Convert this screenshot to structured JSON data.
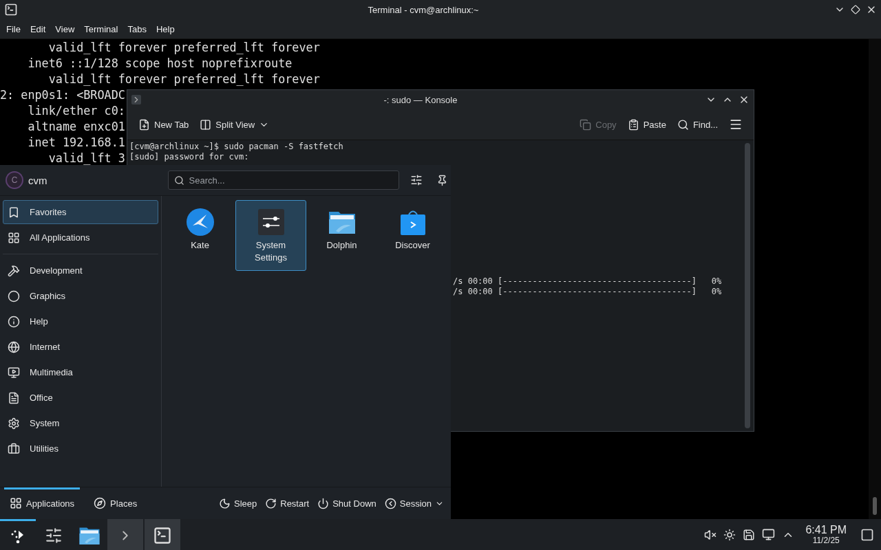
{
  "terminal_window": {
    "title": "Terminal - cvm@archlinux:~",
    "menu": [
      "File",
      "Edit",
      "View",
      "Terminal",
      "Tabs",
      "Help"
    ],
    "lines": [
      "       valid_lft forever preferred_lft forever",
      "    inet6 ::1/128 scope host noprefixroute",
      "       valid_lft forever preferred_lft forever",
      "2: enp0s1: <BROADC",
      "    link/ether c0:",
      "    altname enxc01",
      "    inet 192.168.1",
      "       valid_lft 3"
    ]
  },
  "konsole_window": {
    "title": "-: sudo — Konsole",
    "toolbar": [
      {
        "label": "New Tab",
        "disabled": false
      },
      {
        "label": "Split View",
        "disabled": false
      },
      {
        "label": "Copy",
        "disabled": true
      },
      {
        "label": "Paste",
        "disabled": false
      },
      {
        "label": "Find...",
        "disabled": false
      }
    ],
    "lines": [
      "[cvm@archlinux ~]$ sudo pacman -S fastfetch",
      "[sudo] password for cvm:"
    ],
    "progress_lines": [
      "/s 00:00 [--------------------------------------]   0%",
      "/s 00:00 [--------------------------------------]   0%"
    ]
  },
  "launcher": {
    "user": "cvm",
    "avatar_letter": "C",
    "search": {
      "placeholder": "Search..."
    },
    "categories": [
      {
        "label": "Favorites",
        "selected": true
      },
      {
        "label": "All Applications",
        "selected": false
      },
      {
        "label": "Development",
        "selected": false
      },
      {
        "label": "Graphics",
        "selected": false
      },
      {
        "label": "Help",
        "selected": false
      },
      {
        "label": "Internet",
        "selected": false
      },
      {
        "label": "Multimedia",
        "selected": false
      },
      {
        "label": "Office",
        "selected": false
      },
      {
        "label": "System",
        "selected": false
      },
      {
        "label": "Utilities",
        "selected": false
      }
    ],
    "favorites": [
      {
        "label": "Kate",
        "selected": false
      },
      {
        "label": "System Settings",
        "selected": true
      },
      {
        "label": "Dolphin",
        "selected": false
      },
      {
        "label": "Discover",
        "selected": false
      }
    ],
    "tabs": [
      {
        "label": "Applications",
        "selected": true
      },
      {
        "label": "Places",
        "selected": false
      }
    ],
    "actions": [
      "Sleep",
      "Restart",
      "Shut Down",
      "Session"
    ]
  },
  "taskbar": {
    "tasks": [
      {
        "selected": true,
        "open": false
      },
      {
        "selected": false,
        "open": false
      },
      {
        "selected": false,
        "open": false
      },
      {
        "selected": false,
        "open": true
      },
      {
        "selected": false,
        "open": true
      }
    ],
    "time": "6:41 PM",
    "date": "11/2/25"
  }
}
